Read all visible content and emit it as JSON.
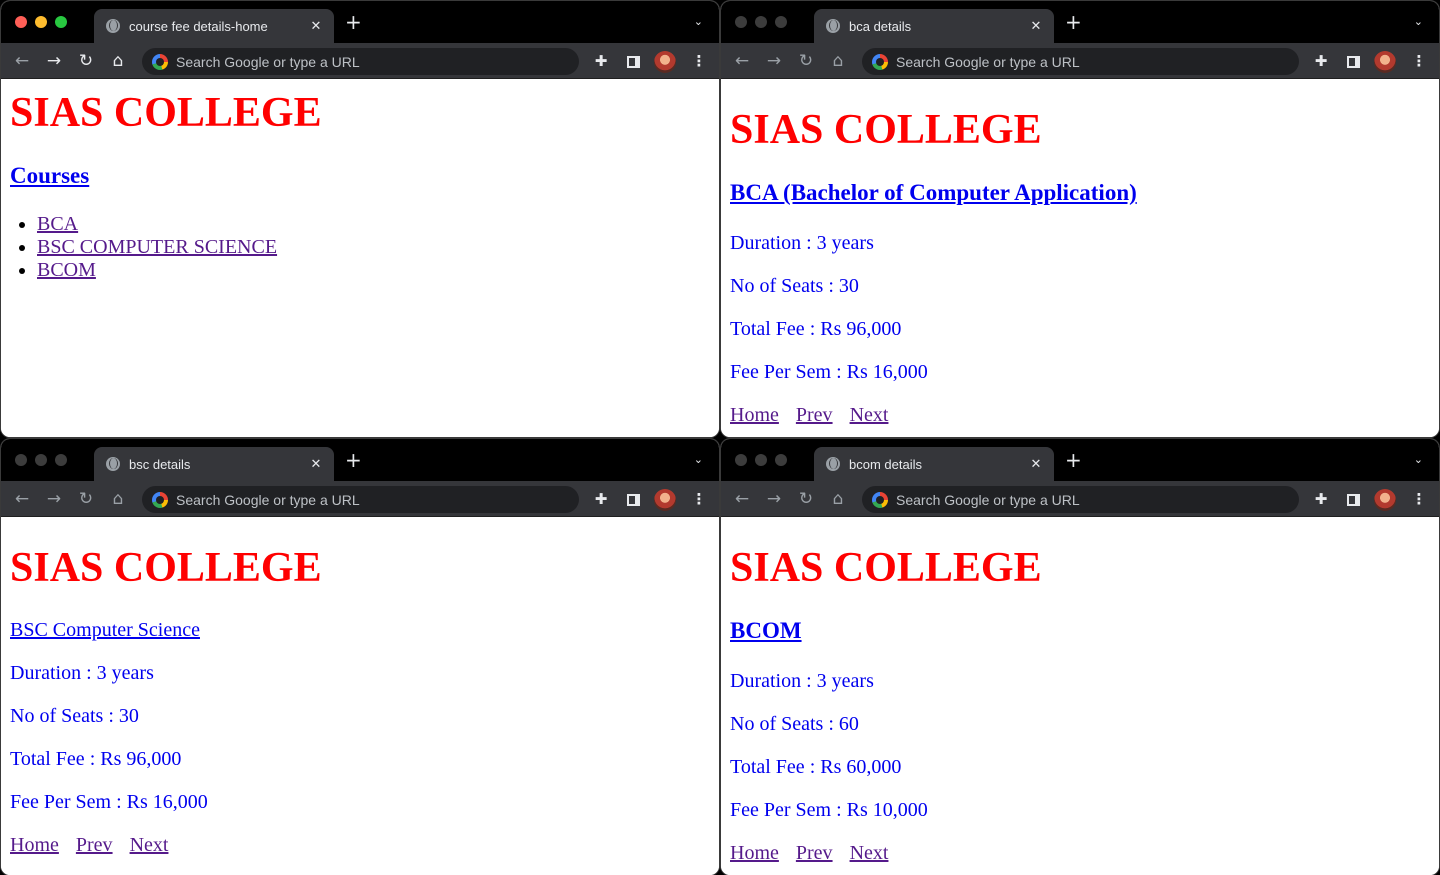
{
  "omnibox_placeholder": "Search Google or type a URL",
  "colors": {
    "heading": "#ff0000",
    "link": "#0000ee",
    "visited": "#551a8b",
    "chrome_dark": "#35363a"
  },
  "windows": [
    {
      "tab_title": "course fee details-home",
      "page": {
        "title": "SIAS COLLEGE",
        "heading": "Courses",
        "courses": [
          "BCA",
          "BSC COMPUTER SCIENCE",
          "BCOM"
        ]
      }
    },
    {
      "tab_title": "bca details",
      "page": {
        "title": "SIAS COLLEGE",
        "heading": "BCA (Bachelor of Computer Application)",
        "duration": "Duration : 3 years",
        "seats": "No of Seats : 30",
        "total_fee": "Total Fee : Rs 96,000",
        "fee_per_sem": "Fee Per Sem : Rs 16,000",
        "links": [
          "Home",
          "Prev",
          "Next"
        ]
      }
    },
    {
      "tab_title": "bsc details",
      "page": {
        "title": "SIAS COLLEGE",
        "heading": "BSC Computer Science",
        "duration": "Duration : 3 years",
        "seats": "No of Seats : 30",
        "total_fee": "Total Fee : Rs 96,000",
        "fee_per_sem": "Fee Per Sem : Rs 16,000",
        "links": [
          "Home",
          "Prev",
          "Next"
        ]
      }
    },
    {
      "tab_title": "bcom details",
      "page": {
        "title": "SIAS COLLEGE",
        "heading": "BCOM",
        "duration": "Duration : 3 years",
        "seats": "No of Seats : 60",
        "total_fee": "Total Fee : Rs 60,000",
        "fee_per_sem": "Fee Per Sem : Rs 10,000",
        "links": [
          "Home",
          "Prev",
          "Next"
        ]
      }
    }
  ]
}
